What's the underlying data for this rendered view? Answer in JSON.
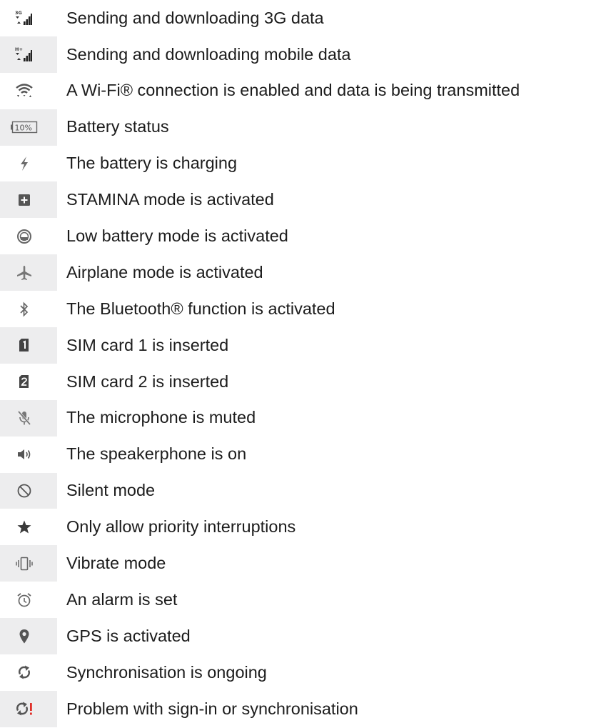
{
  "items": [
    {
      "icon": "3g-data-transfer-icon",
      "label": "Sending and downloading 3G data"
    },
    {
      "icon": "mobile-data-transfer-icon",
      "label": "Sending and downloading mobile data"
    },
    {
      "icon": "wifi-data-transfer-icon",
      "label": "A Wi-Fi® connection is enabled and data is being transmitted"
    },
    {
      "icon": "battery-status-icon",
      "label": "Battery status",
      "icon_text": "10%"
    },
    {
      "icon": "charging-bolt-icon",
      "label": "The battery is charging"
    },
    {
      "icon": "stamina-mode-icon",
      "label": "STAMINA mode is activated"
    },
    {
      "icon": "low-battery-mode-icon",
      "label": "Low battery mode is activated"
    },
    {
      "icon": "airplane-icon",
      "label": "Airplane mode is activated"
    },
    {
      "icon": "bluetooth-icon",
      "label": "The Bluetooth® function is activated"
    },
    {
      "icon": "sim-card-1-icon",
      "label": "SIM card 1 is inserted"
    },
    {
      "icon": "sim-card-2-icon",
      "label": "SIM card 2 is inserted"
    },
    {
      "icon": "microphone-muted-icon",
      "label": "The microphone is muted"
    },
    {
      "icon": "speakerphone-icon",
      "label": "The speakerphone is on"
    },
    {
      "icon": "silent-mode-icon",
      "label": "Silent mode"
    },
    {
      "icon": "priority-star-icon",
      "label": "Only allow priority interruptions"
    },
    {
      "icon": "vibrate-icon",
      "label": "Vibrate mode"
    },
    {
      "icon": "alarm-clock-icon",
      "label": "An alarm is set"
    },
    {
      "icon": "gps-pin-icon",
      "label": "GPS is activated"
    },
    {
      "icon": "sync-icon",
      "label": "Synchronisation is ongoing"
    },
    {
      "icon": "sync-problem-icon",
      "label": "Problem with sign-in or synchronisation"
    }
  ],
  "colors": {
    "icon_cell_shade": "#ededee",
    "icon_gray": "#6b6b6b",
    "error_red": "#e0302a",
    "text": "#1c1c1c"
  }
}
